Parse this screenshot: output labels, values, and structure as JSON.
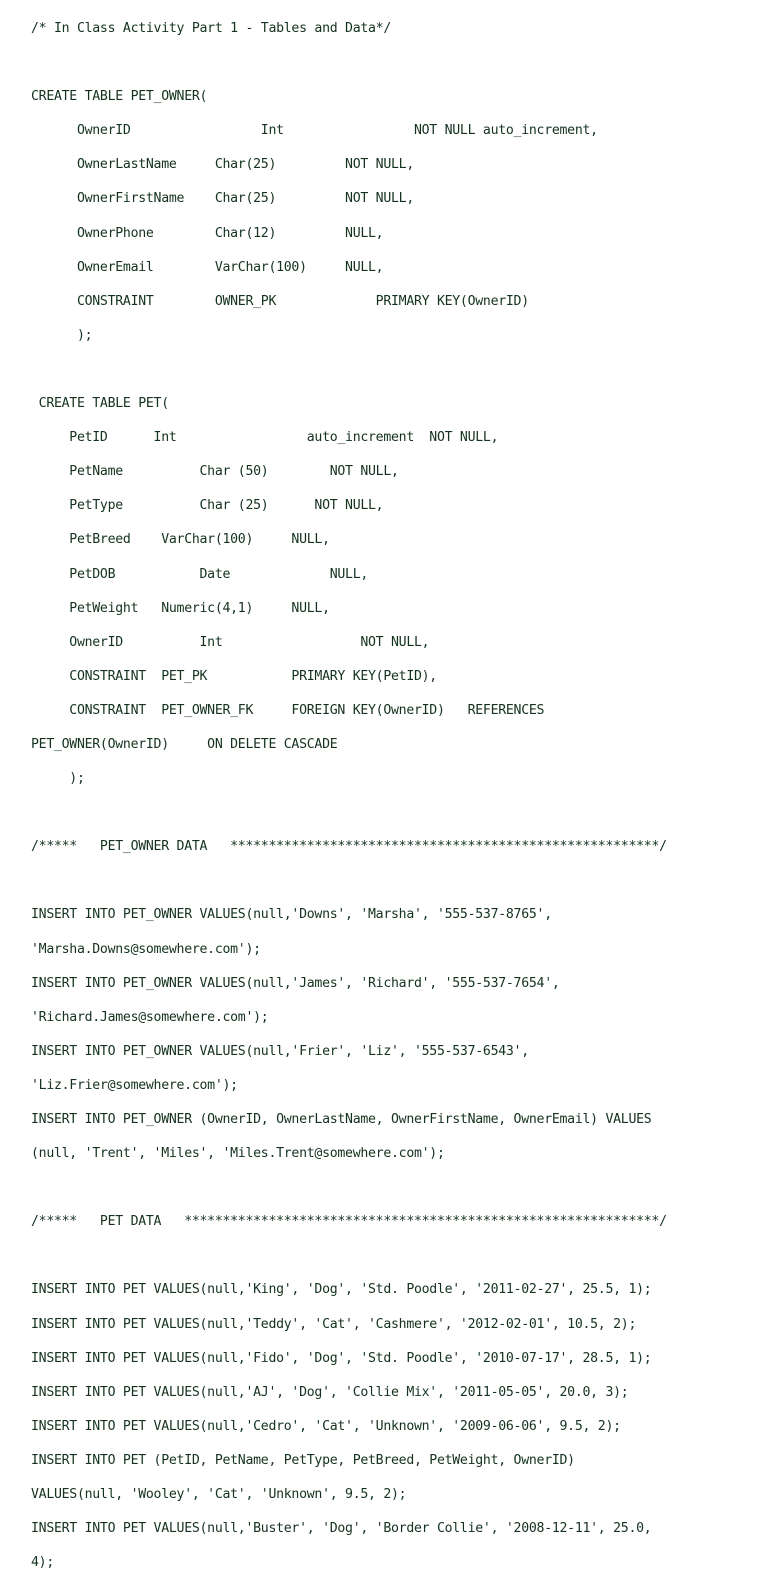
{
  "document": {
    "kind": "sql-script",
    "title_comment": "/* In Class Activity Part 1 - Tables and Data*/",
    "text_color": "#14321e",
    "background_color": "#ffffff",
    "lines": [
      "/* In Class Activity Part 1 - Tables and Data*/",
      "",
      "CREATE TABLE PET_OWNER(",
      "      OwnerID                 Int                 NOT NULL auto_increment,",
      "      OwnerLastName     Char(25)         NOT NULL,",
      "      OwnerFirstName    Char(25)         NOT NULL,",
      "      OwnerPhone        Char(12)         NULL,",
      "      OwnerEmail        VarChar(100)     NULL,",
      "      CONSTRAINT        OWNER_PK             PRIMARY KEY(OwnerID)",
      "      );",
      "",
      " CREATE TABLE PET(",
      "     PetID      Int                 auto_increment  NOT NULL,",
      "     PetName          Char (50)        NOT NULL,",
      "     PetType          Char (25)      NOT NULL,",
      "     PetBreed    VarChar(100)     NULL,",
      "     PetDOB           Date             NULL,",
      "     PetWeight   Numeric(4,1)     NULL,",
      "     OwnerID          Int                  NOT NULL,",
      "     CONSTRAINT  PET_PK           PRIMARY KEY(PetID),",
      "     CONSTRAINT  PET_OWNER_FK     FOREIGN KEY(OwnerID)   REFERENCES",
      "PET_OWNER(OwnerID)     ON DELETE CASCADE",
      "     );",
      "",
      "/*****   PET_OWNER DATA   ********************************************************/",
      "",
      "INSERT INTO PET_OWNER VALUES(null,'Downs', 'Marsha', '555-537-8765',",
      "'Marsha.Downs@somewhere.com');",
      "INSERT INTO PET_OWNER VALUES(null,'James', 'Richard', '555-537-7654',",
      "'Richard.James@somewhere.com');",
      "INSERT INTO PET_OWNER VALUES(null,'Frier', 'Liz', '555-537-6543',",
      "'Liz.Frier@somewhere.com');",
      "INSERT INTO PET_OWNER (OwnerID, OwnerLastName, OwnerFirstName, OwnerEmail) VALUES",
      "(null, 'Trent', 'Miles', 'Miles.Trent@somewhere.com');",
      "",
      "/*****   PET DATA   **************************************************************/",
      "",
      "INSERT INTO PET VALUES(null,'King', 'Dog', 'Std. Poodle', '2011-02-27', 25.5, 1);",
      "INSERT INTO PET VALUES(null,'Teddy', 'Cat', 'Cashmere', '2012-02-01', 10.5, 2);",
      "INSERT INTO PET VALUES(null,'Fido', 'Dog', 'Std. Poodle', '2010-07-17', 28.5, 1);",
      "INSERT INTO PET VALUES(null,'AJ', 'Dog', 'Collie Mix', '2011-05-05', 20.0, 3);",
      "INSERT INTO PET VALUES(null,'Cedro', 'Cat', 'Unknown', '2009-06-06', 9.5, 2);",
      "INSERT INTO PET (PetID, PetName, PetType, PetBreed, PetWeight, OwnerID)",
      "VALUES(null, 'Wooley', 'Cat', 'Unknown', 9.5, 2);",
      "INSERT INTO PET VALUES(null,'Buster', 'Dog', 'Border Collie', '2008-12-11', 25.0,",
      "4);"
    ],
    "statements": {
      "create_tables": [
        {
          "table": "PET_OWNER",
          "columns": [
            {
              "name": "OwnerID",
              "type": "Int",
              "constraints": "NOT NULL auto_increment"
            },
            {
              "name": "OwnerLastName",
              "type": "Char(25)",
              "constraints": "NOT NULL"
            },
            {
              "name": "OwnerFirstName",
              "type": "Char(25)",
              "constraints": "NOT NULL"
            },
            {
              "name": "OwnerPhone",
              "type": "Char(12)",
              "constraints": "NULL"
            },
            {
              "name": "OwnerEmail",
              "type": "VarChar(100)",
              "constraints": "NULL"
            }
          ],
          "table_constraints": [
            {
              "name": "OWNER_PK",
              "definition": "PRIMARY KEY(OwnerID)"
            }
          ]
        },
        {
          "table": "PET",
          "columns": [
            {
              "name": "PetID",
              "type": "Int",
              "constraints": "auto_increment  NOT NULL"
            },
            {
              "name": "PetName",
              "type": "Char (50)",
              "constraints": "NOT NULL"
            },
            {
              "name": "PetType",
              "type": "Char (25)",
              "constraints": "NOT NULL"
            },
            {
              "name": "PetBreed",
              "type": "VarChar(100)",
              "constraints": "NULL"
            },
            {
              "name": "PetDOB",
              "type": "Date",
              "constraints": "NULL"
            },
            {
              "name": "PetWeight",
              "type": "Numeric(4,1)",
              "constraints": "NULL"
            },
            {
              "name": "OwnerID",
              "type": "Int",
              "constraints": "NOT NULL"
            }
          ],
          "table_constraints": [
            {
              "name": "PET_PK",
              "definition": "PRIMARY KEY(PetID)"
            },
            {
              "name": "PET_OWNER_FK",
              "definition": "FOREIGN KEY(OwnerID) REFERENCES PET_OWNER(OwnerID) ON DELETE CASCADE"
            }
          ]
        }
      ],
      "section_banners": [
        "/*****   PET_OWNER DATA   ********************************************************/",
        "/*****   PET DATA   **************************************************************/"
      ],
      "pet_owner_rows": [
        {
          "id": "null",
          "last_name": "Downs",
          "first_name": "Marsha",
          "phone": "555-537-8765",
          "email": "Marsha.Downs@somewhere.com"
        },
        {
          "id": "null",
          "last_name": "James",
          "first_name": "Richard",
          "phone": "555-537-7654",
          "email": "Richard.James@somewhere.com"
        },
        {
          "id": "null",
          "last_name": "Frier",
          "first_name": "Liz",
          "phone": "555-537-6543",
          "email": "Liz.Frier@somewhere.com"
        },
        {
          "id": "null",
          "last_name": "Trent",
          "first_name": "Miles",
          "phone": "",
          "email": "Miles.Trent@somewhere.com"
        }
      ],
      "pet_rows": [
        {
          "id": "null",
          "name": "King",
          "type": "Dog",
          "breed": "Std. Poodle",
          "dob": "2011-02-27",
          "weight": "25.5",
          "owner_id": "1"
        },
        {
          "id": "null",
          "name": "Teddy",
          "type": "Cat",
          "breed": "Cashmere",
          "dob": "2012-02-01",
          "weight": "10.5",
          "owner_id": "2"
        },
        {
          "id": "null",
          "name": "Fido",
          "type": "Dog",
          "breed": "Std. Poodle",
          "dob": "2010-07-17",
          "weight": "28.5",
          "owner_id": "1"
        },
        {
          "id": "null",
          "name": "AJ",
          "type": "Dog",
          "breed": "Collie Mix",
          "dob": "2011-05-05",
          "weight": "20.0",
          "owner_id": "3"
        },
        {
          "id": "null",
          "name": "Cedro",
          "type": "Cat",
          "breed": "Unknown",
          "dob": "2009-06-06",
          "weight": "9.5",
          "owner_id": "2"
        },
        {
          "id": "null",
          "name": "Wooley",
          "type": "Cat",
          "breed": "Unknown",
          "dob": "",
          "weight": "9.5",
          "owner_id": "2"
        },
        {
          "id": "null",
          "name": "Buster",
          "type": "Dog",
          "breed": "Border Collie",
          "dob": "2008-12-11",
          "weight": "25.0",
          "owner_id": "4"
        }
      ]
    }
  }
}
